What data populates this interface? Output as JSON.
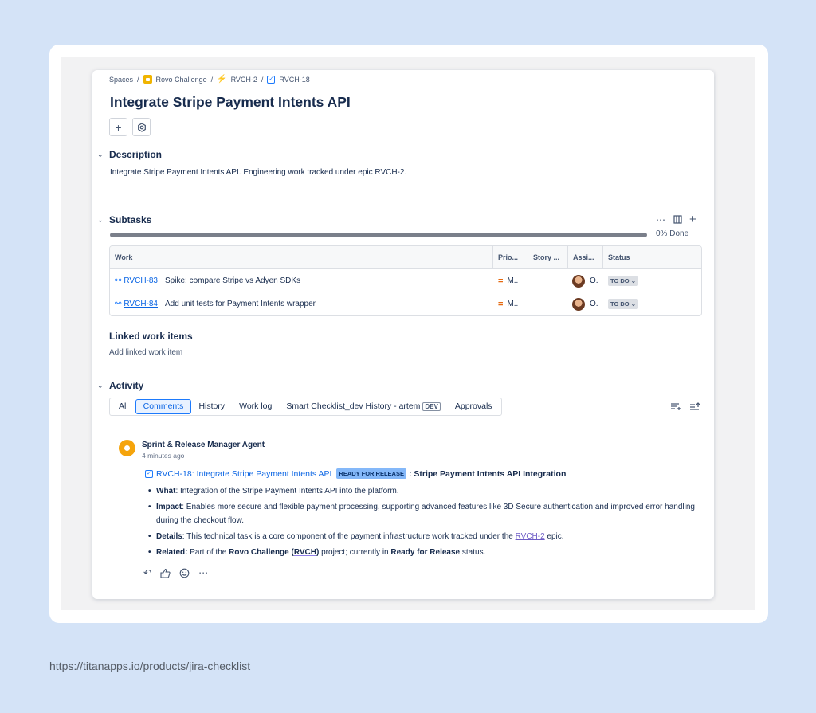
{
  "breadcrumb": {
    "spaces": "Spaces",
    "sep": "/",
    "project": "Rovo Challenge",
    "epic": "RVCH-2",
    "issue": "RVCH-18"
  },
  "title": "Integrate Stripe Payment Intents API",
  "description": {
    "heading": "Description",
    "text": "Integrate Stripe Payment Intents API. Engineering work tracked under epic RVCH-2."
  },
  "subtasks": {
    "heading": "Subtasks",
    "progress_percent": 0,
    "progress_label": "0% Done",
    "columns": [
      "Work",
      "Prio...",
      "Story ...",
      "Assi...",
      "Status"
    ],
    "rows": [
      {
        "key": "RVCH-83",
        "summary": "Spike: compare Stripe vs Adyen SDKs",
        "priority": "M..",
        "story": "",
        "assignee": "O.",
        "status": "TO DO"
      },
      {
        "key": "RVCH-84",
        "summary": "Add unit tests for Payment Intents wrapper",
        "priority": "M..",
        "story": "",
        "assignee": "O.",
        "status": "TO DO"
      }
    ]
  },
  "linked": {
    "heading": "Linked work items",
    "add_label": "Add linked work item"
  },
  "activity": {
    "heading": "Activity",
    "tabs": [
      {
        "label": "All"
      },
      {
        "label": "Comments"
      },
      {
        "label": "History"
      },
      {
        "label": "Work log"
      },
      {
        "label": "Smart Checklist_dev History - artem",
        "badge": "DEV"
      },
      {
        "label": "Approvals"
      }
    ],
    "active_tab": "Comments"
  },
  "comment": {
    "author": "Sprint & Release Manager Agent",
    "time": "4 minutes ago",
    "link_text": "RVCH-18: Integrate Stripe Payment Intents API",
    "badge": "READY FOR RELEASE",
    "headline": ": Stripe Payment Intents API Integration",
    "bullets": {
      "what_label": "What",
      "what_text": ": Integration of the Stripe Payment Intents API into the platform.",
      "impact_label": "Impact",
      "impact_text": ": Enables more secure and flexible payment processing, supporting advanced features like 3D Secure authentication and improved error handling during the checkout flow.",
      "details_label": "Details",
      "details_text_1": ": This technical task is a core component of the payment infrastructure work tracked under the ",
      "details_link": "RVCH-2",
      "details_text_2": " epic.",
      "related_label": "Related:",
      "related_text_1": " Part of the ",
      "related_bold_1": "Rovo Challenge (",
      "related_bold_2": "RVCH",
      "related_bold_3": ")",
      "related_text_2": " project; currently in ",
      "related_bold_4": "Ready for Release",
      "related_text_3": " status."
    }
  },
  "footer_url": "https://titanapps.io/products/jira-checklist",
  "colors": {
    "page_bg": "#d4e3f7",
    "link": "#0c66e4",
    "priority_medium": "#e56910",
    "agent_avatar": "#f5a40c",
    "ready_badge": "#84b8f9"
  },
  "icons": {
    "breadcrumb_project": "project-avatar-icon",
    "breadcrumb_epic": "epic-icon",
    "breadcrumb_issue": "task-checkbox-icon",
    "toolbar": [
      "plus-icon",
      "settings-icon"
    ],
    "subtask_row": "subtask-icon",
    "priority": "priority-medium-icon",
    "activity_tools": [
      "filter-icon",
      "sort-icon"
    ],
    "reactions": [
      "reply-icon",
      "thumbs-up-icon",
      "emoji-icon",
      "more-icon"
    ]
  }
}
